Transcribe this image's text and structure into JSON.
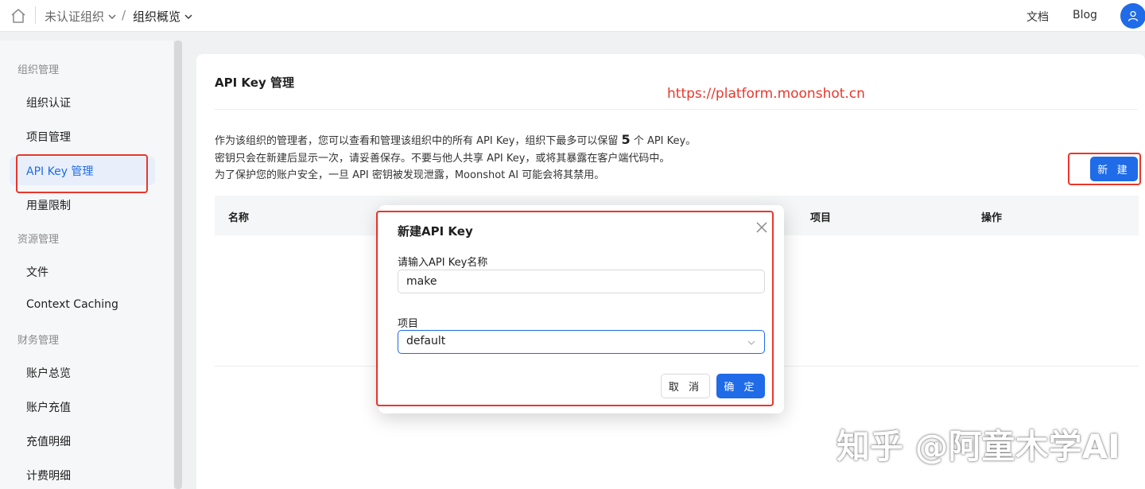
{
  "topbar": {
    "org_name": "未认证组织",
    "separator": "/",
    "current_page": "组织概览",
    "links": {
      "docs": "文档",
      "blog": "Blog"
    }
  },
  "sidebar": {
    "groups": [
      {
        "label": "组织管理",
        "items": [
          "组织认证",
          "项目管理",
          "API Key 管理",
          "用量限制"
        ]
      },
      {
        "label": "资源管理",
        "items": [
          "文件",
          "Context Caching"
        ]
      },
      {
        "label": "财务管理",
        "items": [
          "账户总览",
          "账户充值",
          "充值明细",
          "计费明细"
        ]
      }
    ],
    "active_item": "API Key 管理"
  },
  "main": {
    "title": "API Key 管理",
    "annotation_url": "https://platform.moonshot.cn",
    "desc_line1_pre": "作为该组织的管理者，您可以查看和管理该组织中的所有 API Key，组织下最多可以保留 ",
    "desc_limit": "5",
    "desc_line1_post": " 个 API Key。",
    "desc_line2": "密钥只会在新建后显示一次，请妥善保存。不要与他人共享 API Key，或将其暴露在客户端代码中。",
    "desc_line3": "为了保护您的账户安全，一旦 API 密钥被发现泄露，Moonshot AI 可能会将其禁用。",
    "new_button": "新 建",
    "table_headers": {
      "name": "名称",
      "project": "项目",
      "actions": "操作"
    }
  },
  "modal": {
    "title": "新建API Key",
    "name_label": "请输入API Key名称",
    "name_value": "make",
    "project_label": "项目",
    "project_value": "default",
    "cancel": "取 消",
    "ok": "确 定"
  },
  "watermark": "知乎 @阿童木学AI",
  "colors": {
    "accent": "#1f6be8",
    "annotation_red": "#e8372c"
  },
  "icons": [
    "home-icon",
    "chevron-down-icon",
    "user-icon",
    "close-icon"
  ]
}
